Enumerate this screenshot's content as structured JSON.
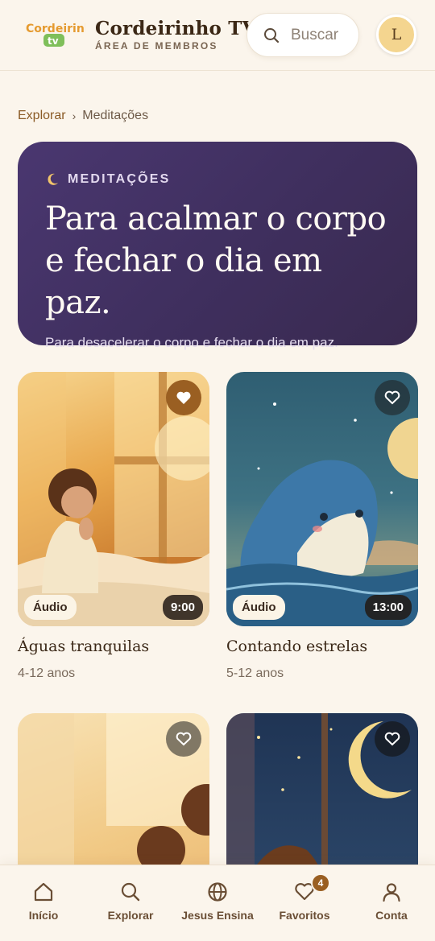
{
  "header": {
    "logo_text": "Cordeirinho tv",
    "title": "Cordeirinho TV",
    "subtitle": "ÁREA DE MEMBROS",
    "search_placeholder": "Buscar",
    "avatar_initial": "L"
  },
  "breadcrumb": {
    "items": [
      "Explorar",
      "Meditações"
    ],
    "separator": "›"
  },
  "hero": {
    "tag": "MEDITAÇÕES",
    "title_line1": "Para acalmar o corpo",
    "title_line2": "e fechar o dia em paz.",
    "subtitle": "Para desacelerar o corpo e fechar o dia em paz."
  },
  "cards": [
    {
      "title": "Águas tranquilas",
      "age": "4-12 anos",
      "type": "Áudio",
      "duration": "9:00",
      "favorited": true
    },
    {
      "title": "Contando estrelas",
      "age": "5-12 anos",
      "type": "Áudio",
      "duration": "13:00",
      "favorited": false
    },
    {
      "title": "",
      "age": "",
      "favorited": false
    },
    {
      "title": "",
      "age": "",
      "favorited": false
    }
  ],
  "bottom_nav": {
    "items": [
      {
        "label": "Início",
        "icon": "home-icon"
      },
      {
        "label": "Explorar",
        "icon": "search-icon"
      },
      {
        "label": "Jesus Ensina",
        "icon": "globe-icon"
      },
      {
        "label": "Favoritos",
        "icon": "heart-icon",
        "badge": "4"
      },
      {
        "label": "Conta",
        "icon": "user-icon"
      }
    ]
  },
  "colors": {
    "background": "#fbf5ec",
    "hero": "#45346a",
    "accent": "#9a5f22"
  }
}
